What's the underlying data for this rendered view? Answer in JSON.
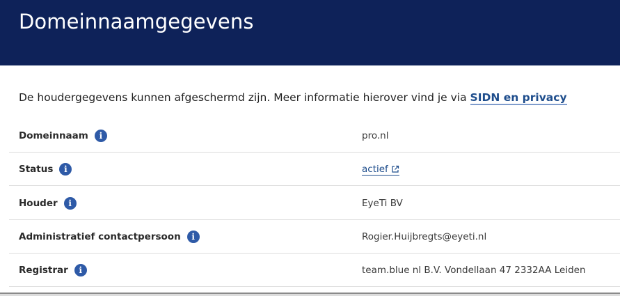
{
  "header": {
    "title": "Domeinnaamgegevens"
  },
  "intro": {
    "text": "De houdergegevens kunnen afgeschermd zijn. Meer informatie hierover vind je via ",
    "link_label": "SIDN en privacy"
  },
  "rows": [
    {
      "label": "Domeinnaam",
      "value": "pro.nl",
      "info_icon": "info-icon"
    },
    {
      "label": "Status",
      "value": "actief",
      "info_icon": "info-icon",
      "value_is_link": true,
      "value_icon": "external-link-icon"
    },
    {
      "label": "Houder",
      "value": "EyeTi BV",
      "info_icon": "info-icon"
    },
    {
      "label": "Administratief contactpersoon",
      "value": "Rogier.Huijbregts@eyeti.nl",
      "info_icon": "info-icon"
    },
    {
      "label": "Registrar",
      "value": "team.blue nl B.V. Vondellaan 47 2332AA Leiden",
      "info_icon": "info-icon"
    }
  ],
  "colors": {
    "header_bg": "#0e2259",
    "link": "#1e4d8c",
    "info_icon_bg": "#2e5aa7"
  }
}
